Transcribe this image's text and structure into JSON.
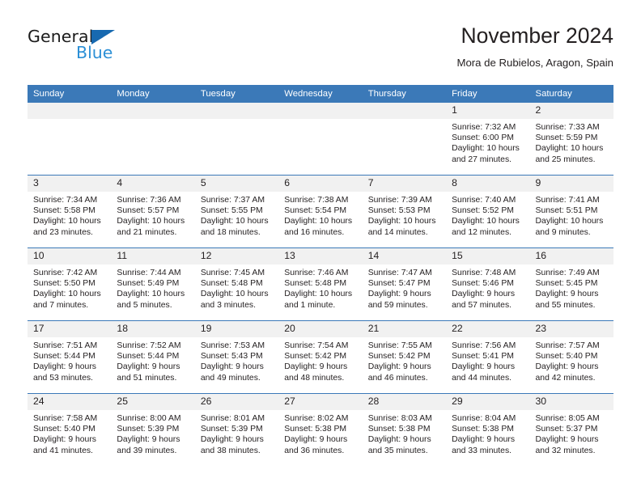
{
  "brand": {
    "line1": "General",
    "line2": "Blue",
    "triangle_icon": "triangle-icon",
    "color_dark": "#1b1b1b",
    "color_blue": "#2b8fd6",
    "triangle_color": "#1769b0"
  },
  "header": {
    "title": "November 2024",
    "subtitle": "Mora de Rubielos, Aragon, Spain"
  },
  "theme": {
    "header_blue": "#3b79b8",
    "daynum_band": "#f1f1f1",
    "text": "#231f20"
  },
  "weekday_headers": [
    "Sunday",
    "Monday",
    "Tuesday",
    "Wednesday",
    "Thursday",
    "Friday",
    "Saturday"
  ],
  "weeks": [
    [
      {
        "day": "",
        "blank": true
      },
      {
        "day": "",
        "blank": true
      },
      {
        "day": "",
        "blank": true
      },
      {
        "day": "",
        "blank": true
      },
      {
        "day": "",
        "blank": true
      },
      {
        "day": "1",
        "sunrise": "Sunrise: 7:32 AM",
        "sunset": "Sunset: 6:00 PM",
        "daylight": "Daylight: 10 hours and 27 minutes."
      },
      {
        "day": "2",
        "sunrise": "Sunrise: 7:33 AM",
        "sunset": "Sunset: 5:59 PM",
        "daylight": "Daylight: 10 hours and 25 minutes."
      }
    ],
    [
      {
        "day": "3",
        "sunrise": "Sunrise: 7:34 AM",
        "sunset": "Sunset: 5:58 PM",
        "daylight": "Daylight: 10 hours and 23 minutes."
      },
      {
        "day": "4",
        "sunrise": "Sunrise: 7:36 AM",
        "sunset": "Sunset: 5:57 PM",
        "daylight": "Daylight: 10 hours and 21 minutes."
      },
      {
        "day": "5",
        "sunrise": "Sunrise: 7:37 AM",
        "sunset": "Sunset: 5:55 PM",
        "daylight": "Daylight: 10 hours and 18 minutes."
      },
      {
        "day": "6",
        "sunrise": "Sunrise: 7:38 AM",
        "sunset": "Sunset: 5:54 PM",
        "daylight": "Daylight: 10 hours and 16 minutes."
      },
      {
        "day": "7",
        "sunrise": "Sunrise: 7:39 AM",
        "sunset": "Sunset: 5:53 PM",
        "daylight": "Daylight: 10 hours and 14 minutes."
      },
      {
        "day": "8",
        "sunrise": "Sunrise: 7:40 AM",
        "sunset": "Sunset: 5:52 PM",
        "daylight": "Daylight: 10 hours and 12 minutes."
      },
      {
        "day": "9",
        "sunrise": "Sunrise: 7:41 AM",
        "sunset": "Sunset: 5:51 PM",
        "daylight": "Daylight: 10 hours and 9 minutes."
      }
    ],
    [
      {
        "day": "10",
        "sunrise": "Sunrise: 7:42 AM",
        "sunset": "Sunset: 5:50 PM",
        "daylight": "Daylight: 10 hours and 7 minutes."
      },
      {
        "day": "11",
        "sunrise": "Sunrise: 7:44 AM",
        "sunset": "Sunset: 5:49 PM",
        "daylight": "Daylight: 10 hours and 5 minutes."
      },
      {
        "day": "12",
        "sunrise": "Sunrise: 7:45 AM",
        "sunset": "Sunset: 5:48 PM",
        "daylight": "Daylight: 10 hours and 3 minutes."
      },
      {
        "day": "13",
        "sunrise": "Sunrise: 7:46 AM",
        "sunset": "Sunset: 5:48 PM",
        "daylight": "Daylight: 10 hours and 1 minute."
      },
      {
        "day": "14",
        "sunrise": "Sunrise: 7:47 AM",
        "sunset": "Sunset: 5:47 PM",
        "daylight": "Daylight: 9 hours and 59 minutes."
      },
      {
        "day": "15",
        "sunrise": "Sunrise: 7:48 AM",
        "sunset": "Sunset: 5:46 PM",
        "daylight": "Daylight: 9 hours and 57 minutes."
      },
      {
        "day": "16",
        "sunrise": "Sunrise: 7:49 AM",
        "sunset": "Sunset: 5:45 PM",
        "daylight": "Daylight: 9 hours and 55 minutes."
      }
    ],
    [
      {
        "day": "17",
        "sunrise": "Sunrise: 7:51 AM",
        "sunset": "Sunset: 5:44 PM",
        "daylight": "Daylight: 9 hours and 53 minutes."
      },
      {
        "day": "18",
        "sunrise": "Sunrise: 7:52 AM",
        "sunset": "Sunset: 5:44 PM",
        "daylight": "Daylight: 9 hours and 51 minutes."
      },
      {
        "day": "19",
        "sunrise": "Sunrise: 7:53 AM",
        "sunset": "Sunset: 5:43 PM",
        "daylight": "Daylight: 9 hours and 49 minutes."
      },
      {
        "day": "20",
        "sunrise": "Sunrise: 7:54 AM",
        "sunset": "Sunset: 5:42 PM",
        "daylight": "Daylight: 9 hours and 48 minutes."
      },
      {
        "day": "21",
        "sunrise": "Sunrise: 7:55 AM",
        "sunset": "Sunset: 5:42 PM",
        "daylight": "Daylight: 9 hours and 46 minutes."
      },
      {
        "day": "22",
        "sunrise": "Sunrise: 7:56 AM",
        "sunset": "Sunset: 5:41 PM",
        "daylight": "Daylight: 9 hours and 44 minutes."
      },
      {
        "day": "23",
        "sunrise": "Sunrise: 7:57 AM",
        "sunset": "Sunset: 5:40 PM",
        "daylight": "Daylight: 9 hours and 42 minutes."
      }
    ],
    [
      {
        "day": "24",
        "sunrise": "Sunrise: 7:58 AM",
        "sunset": "Sunset: 5:40 PM",
        "daylight": "Daylight: 9 hours and 41 minutes."
      },
      {
        "day": "25",
        "sunrise": "Sunrise: 8:00 AM",
        "sunset": "Sunset: 5:39 PM",
        "daylight": "Daylight: 9 hours and 39 minutes."
      },
      {
        "day": "26",
        "sunrise": "Sunrise: 8:01 AM",
        "sunset": "Sunset: 5:39 PM",
        "daylight": "Daylight: 9 hours and 38 minutes."
      },
      {
        "day": "27",
        "sunrise": "Sunrise: 8:02 AM",
        "sunset": "Sunset: 5:38 PM",
        "daylight": "Daylight: 9 hours and 36 minutes."
      },
      {
        "day": "28",
        "sunrise": "Sunrise: 8:03 AM",
        "sunset": "Sunset: 5:38 PM",
        "daylight": "Daylight: 9 hours and 35 minutes."
      },
      {
        "day": "29",
        "sunrise": "Sunrise: 8:04 AM",
        "sunset": "Sunset: 5:38 PM",
        "daylight": "Daylight: 9 hours and 33 minutes."
      },
      {
        "day": "30",
        "sunrise": "Sunrise: 8:05 AM",
        "sunset": "Sunset: 5:37 PM",
        "daylight": "Daylight: 9 hours and 32 minutes."
      }
    ]
  ]
}
